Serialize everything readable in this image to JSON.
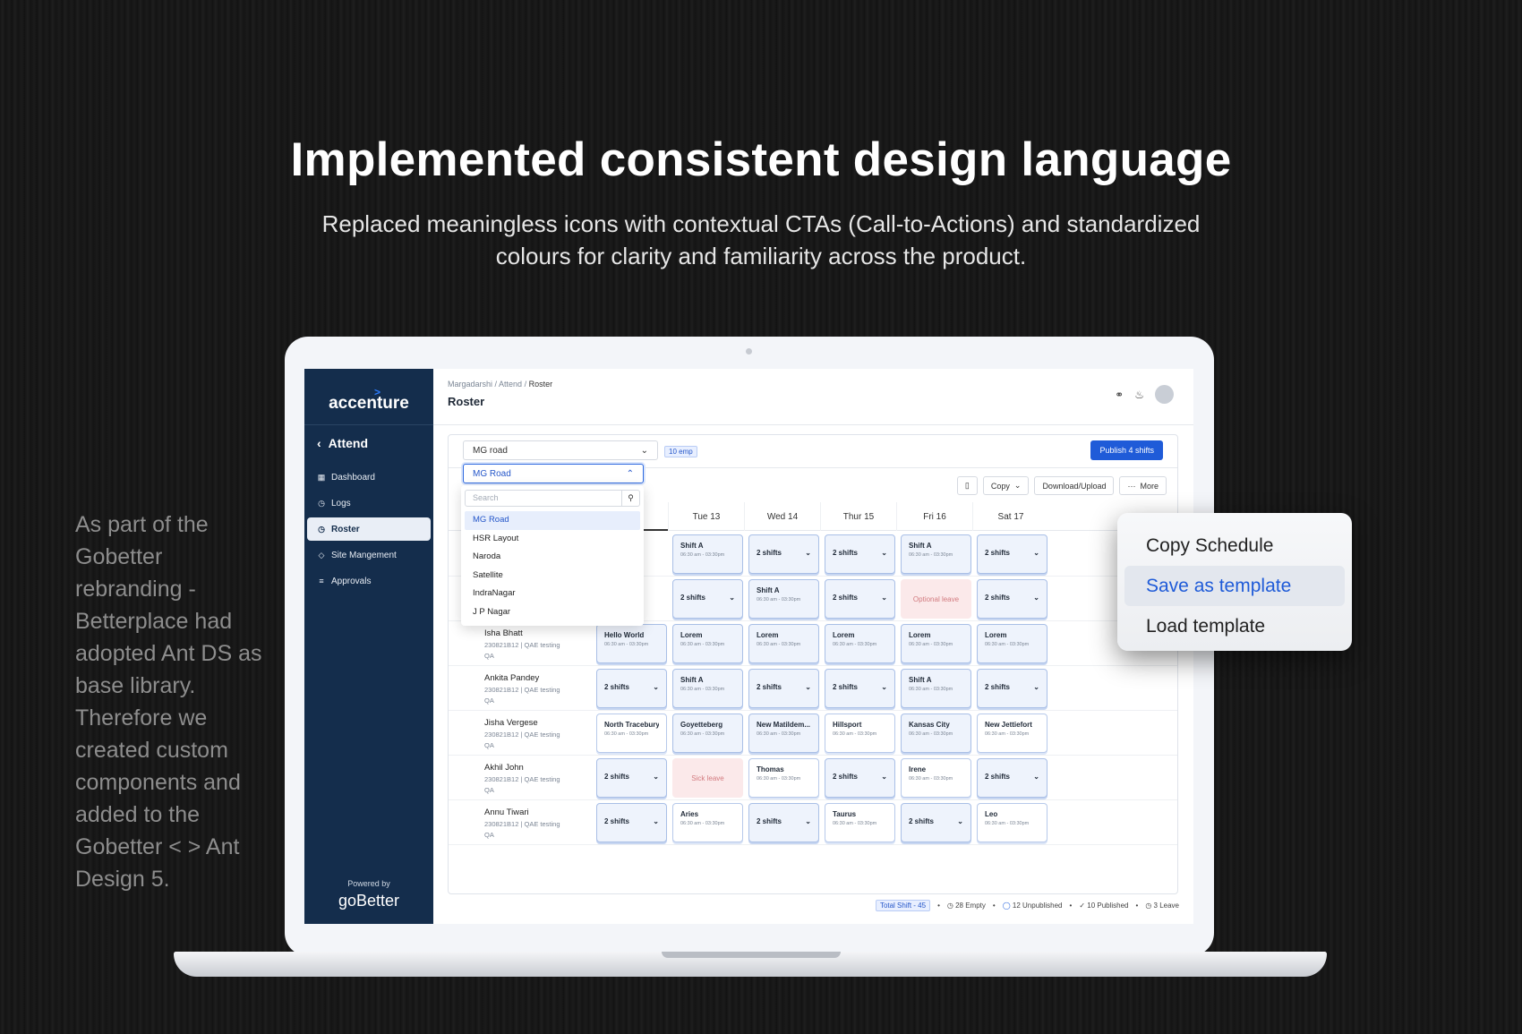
{
  "hero": {
    "title": "Implemented consistent design language",
    "subtitle": "Replaced meaningless icons with contextual CTAs (Call-to-Actions) and standardized colours for clarity and familiarity across the product."
  },
  "side_note": "As part of the Gobetter rebranding - Betterplace had adopted Ant DS as base library. Therefore we created custom components and added to the Gobetter < > Ant Design 5.",
  "sidebar": {
    "logo": "accenture",
    "back_label": "Attend",
    "items": [
      {
        "label": "Dashboard",
        "icon": "dashboard-icon"
      },
      {
        "label": "Logs",
        "icon": "clock-icon"
      },
      {
        "label": "Roster",
        "icon": "clock-icon"
      },
      {
        "label": "Site Mangement",
        "icon": "location-icon"
      },
      {
        "label": "Approvals",
        "icon": "list-icon"
      }
    ],
    "powered_by": "Powered by",
    "brand": "goBetter"
  },
  "header": {
    "breadcrumb": [
      "Margadarshi",
      "Attend",
      "Roster"
    ],
    "title": "Roster"
  },
  "toolbar": {
    "location_value": "MG road",
    "emp_count": "10 emp",
    "publish_label": "Publish 4 shifts",
    "copy_label": "Copy",
    "download_label": "Download/Upload",
    "more_label": "More"
  },
  "dropdown": {
    "value": "MG Road",
    "search_placeholder": "Search",
    "options": [
      "MG Road",
      "HSR Layout",
      "Naroda",
      "Satellite",
      "IndraNagar",
      "J P Nagar"
    ]
  },
  "days": [
    "Tue 13",
    "Wed 14",
    "Thur 15",
    "Fri 16",
    "Sat 17"
  ],
  "rows": [
    {
      "name": "",
      "id": "",
      "dept": "",
      "role": "",
      "cells": [
        {
          "t": "shift",
          "title": "Shift A",
          "time": "06:30 am - 03:30pm"
        },
        {
          "t": "shifts",
          "title": "2 shifts"
        },
        {
          "t": "shifts",
          "title": "2 shifts"
        },
        {
          "t": "shift",
          "title": "Shift A",
          "time": "06:30 am - 03:30pm"
        },
        {
          "t": "shifts",
          "title": "2 shifts"
        }
      ]
    },
    {
      "name": "",
      "id": "",
      "dept": "",
      "role": "",
      "cells": [
        {
          "t": "shifts",
          "title": "2 shifts"
        },
        {
          "t": "shift",
          "title": "Shift A",
          "time": "06:30 am - 03:30pm"
        },
        {
          "t": "shifts",
          "title": "2 shifts"
        },
        {
          "t": "leave-opt",
          "title": "Optional leave"
        },
        {
          "t": "shifts",
          "title": "2 shifts"
        }
      ]
    },
    {
      "name": "Isha Bhatt",
      "id": "230821B12",
      "dept": "QAE testing",
      "role": "QA",
      "cells": [
        {
          "t": "shift",
          "title": "Hello World",
          "time": "06:30 am - 03:30pm"
        },
        {
          "t": "shift",
          "title": "Lorem",
          "time": "06:30 am - 03:30pm"
        },
        {
          "t": "shift",
          "title": "Lorem",
          "time": "06:30 am - 03:30pm"
        },
        {
          "t": "shift",
          "title": "Lorem",
          "time": "06:30 am - 03:30pm"
        },
        {
          "t": "shift",
          "title": "Lorem",
          "time": "06:30 am - 03:30pm"
        },
        {
          "t": "shift",
          "title": "Lorem",
          "time": "06:30 am - 03:30pm"
        }
      ]
    },
    {
      "name": "Ankita Pandey",
      "id": "230821B12",
      "dept": "QAE testing",
      "role": "QA",
      "cells": [
        {
          "t": "shifts",
          "title": "2 shifts"
        },
        {
          "t": "shift",
          "title": "Shift A",
          "time": "06:30 am - 03:30pm"
        },
        {
          "t": "shifts",
          "title": "2 shifts"
        },
        {
          "t": "shifts",
          "title": "2 shifts"
        },
        {
          "t": "shift",
          "title": "Shift A",
          "time": "06:30 am - 03:30pm"
        },
        {
          "t": "shifts",
          "title": "2 shifts"
        }
      ]
    },
    {
      "name": "Jisha Vergese",
      "id": "230821B12",
      "dept": "QAE testing",
      "role": "QA",
      "cells": [
        {
          "t": "plain",
          "title": "North Tracebury",
          "time": "06:30 am - 03:30pm"
        },
        {
          "t": "shift",
          "title": "Goyetteberg",
          "time": "06:30 am - 03:30pm"
        },
        {
          "t": "shift",
          "title": "New Matildem...",
          "time": "06:30 am - 03:30pm"
        },
        {
          "t": "plain",
          "title": "Hillsport",
          "time": "06:30 am - 03:30pm"
        },
        {
          "t": "shift",
          "title": "Kansas City",
          "time": "06:30 am - 03:30pm"
        },
        {
          "t": "plain",
          "title": "New Jettiefort",
          "time": "06:30 am - 03:30pm"
        }
      ]
    },
    {
      "name": "Akhil John",
      "id": "230821B12",
      "dept": "QAE testing",
      "role": "QA",
      "cells": [
        {
          "t": "shifts",
          "title": "2 shifts"
        },
        {
          "t": "leave-sick",
          "title": "Sick leave"
        },
        {
          "t": "plain",
          "title": "Thomas",
          "time": "06:30 am - 03:30pm"
        },
        {
          "t": "shifts",
          "title": "2 shifts"
        },
        {
          "t": "plain",
          "title": "Irene",
          "time": "06:30 am - 03:30pm"
        },
        {
          "t": "shifts",
          "title": "2 shifts"
        }
      ]
    },
    {
      "name": "Annu Tiwari",
      "id": "230821B12",
      "dept": "QAE testing",
      "role": "QA",
      "cells": [
        {
          "t": "shifts",
          "title": "2 shifts"
        },
        {
          "t": "plain",
          "title": "Aries",
          "time": "06:30 am - 03:30pm"
        },
        {
          "t": "shifts",
          "title": "2 shifts"
        },
        {
          "t": "plain",
          "title": "Taurus",
          "time": "06:30 am - 03:30pm"
        },
        {
          "t": "shifts",
          "title": "2 shifts"
        },
        {
          "t": "plain",
          "title": "Leo",
          "time": "06:30 am - 03:30pm"
        }
      ]
    }
  ],
  "footer": {
    "total": "Total Shift - 45",
    "empty": "28 Empty",
    "unpublished": "12 Unpublished",
    "published": "10 Published",
    "leave": "3 Leave"
  },
  "context_menu": {
    "items": [
      "Copy Schedule",
      "Save as template",
      "Load template"
    ],
    "highlighted_index": 1
  }
}
